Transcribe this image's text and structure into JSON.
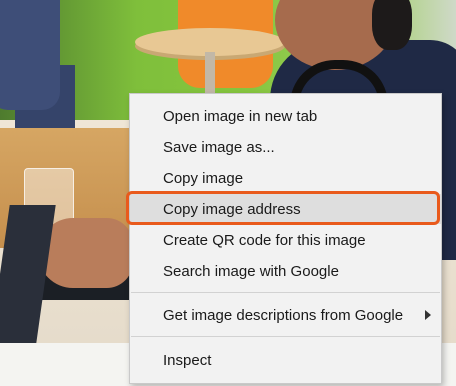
{
  "context_menu": {
    "items": [
      {
        "label": "Open image in new tab"
      },
      {
        "label": "Save image as..."
      },
      {
        "label": "Copy image"
      },
      {
        "label": "Copy image address"
      },
      {
        "label": "Create QR code for this image"
      },
      {
        "label": "Search image with Google"
      },
      {
        "label": "Get image descriptions from Google"
      },
      {
        "label": "Inspect"
      }
    ],
    "highlighted_item": "Copy image address",
    "annotation_color": "#e95a1c"
  },
  "background": {
    "photo_description": null
  }
}
